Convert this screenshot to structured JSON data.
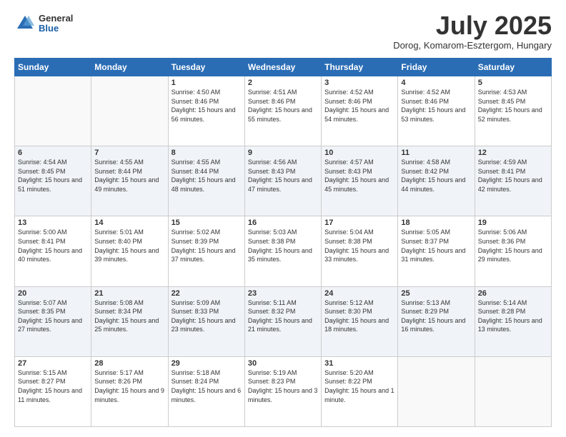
{
  "header": {
    "logo_general": "General",
    "logo_blue": "Blue",
    "title": "July 2025",
    "location": "Dorog, Komarom-Esztergom, Hungary"
  },
  "days_of_week": [
    "Sunday",
    "Monday",
    "Tuesday",
    "Wednesday",
    "Thursday",
    "Friday",
    "Saturday"
  ],
  "weeks": [
    [
      {
        "day": "",
        "sunrise": "",
        "sunset": "",
        "daylight": ""
      },
      {
        "day": "",
        "sunrise": "",
        "sunset": "",
        "daylight": ""
      },
      {
        "day": "1",
        "sunrise": "Sunrise: 4:50 AM",
        "sunset": "Sunset: 8:46 PM",
        "daylight": "Daylight: 15 hours and 56 minutes."
      },
      {
        "day": "2",
        "sunrise": "Sunrise: 4:51 AM",
        "sunset": "Sunset: 8:46 PM",
        "daylight": "Daylight: 15 hours and 55 minutes."
      },
      {
        "day": "3",
        "sunrise": "Sunrise: 4:52 AM",
        "sunset": "Sunset: 8:46 PM",
        "daylight": "Daylight: 15 hours and 54 minutes."
      },
      {
        "day": "4",
        "sunrise": "Sunrise: 4:52 AM",
        "sunset": "Sunset: 8:46 PM",
        "daylight": "Daylight: 15 hours and 53 minutes."
      },
      {
        "day": "5",
        "sunrise": "Sunrise: 4:53 AM",
        "sunset": "Sunset: 8:45 PM",
        "daylight": "Daylight: 15 hours and 52 minutes."
      }
    ],
    [
      {
        "day": "6",
        "sunrise": "Sunrise: 4:54 AM",
        "sunset": "Sunset: 8:45 PM",
        "daylight": "Daylight: 15 hours and 51 minutes."
      },
      {
        "day": "7",
        "sunrise": "Sunrise: 4:55 AM",
        "sunset": "Sunset: 8:44 PM",
        "daylight": "Daylight: 15 hours and 49 minutes."
      },
      {
        "day": "8",
        "sunrise": "Sunrise: 4:55 AM",
        "sunset": "Sunset: 8:44 PM",
        "daylight": "Daylight: 15 hours and 48 minutes."
      },
      {
        "day": "9",
        "sunrise": "Sunrise: 4:56 AM",
        "sunset": "Sunset: 8:43 PM",
        "daylight": "Daylight: 15 hours and 47 minutes."
      },
      {
        "day": "10",
        "sunrise": "Sunrise: 4:57 AM",
        "sunset": "Sunset: 8:43 PM",
        "daylight": "Daylight: 15 hours and 45 minutes."
      },
      {
        "day": "11",
        "sunrise": "Sunrise: 4:58 AM",
        "sunset": "Sunset: 8:42 PM",
        "daylight": "Daylight: 15 hours and 44 minutes."
      },
      {
        "day": "12",
        "sunrise": "Sunrise: 4:59 AM",
        "sunset": "Sunset: 8:41 PM",
        "daylight": "Daylight: 15 hours and 42 minutes."
      }
    ],
    [
      {
        "day": "13",
        "sunrise": "Sunrise: 5:00 AM",
        "sunset": "Sunset: 8:41 PM",
        "daylight": "Daylight: 15 hours and 40 minutes."
      },
      {
        "day": "14",
        "sunrise": "Sunrise: 5:01 AM",
        "sunset": "Sunset: 8:40 PM",
        "daylight": "Daylight: 15 hours and 39 minutes."
      },
      {
        "day": "15",
        "sunrise": "Sunrise: 5:02 AM",
        "sunset": "Sunset: 8:39 PM",
        "daylight": "Daylight: 15 hours and 37 minutes."
      },
      {
        "day": "16",
        "sunrise": "Sunrise: 5:03 AM",
        "sunset": "Sunset: 8:38 PM",
        "daylight": "Daylight: 15 hours and 35 minutes."
      },
      {
        "day": "17",
        "sunrise": "Sunrise: 5:04 AM",
        "sunset": "Sunset: 8:38 PM",
        "daylight": "Daylight: 15 hours and 33 minutes."
      },
      {
        "day": "18",
        "sunrise": "Sunrise: 5:05 AM",
        "sunset": "Sunset: 8:37 PM",
        "daylight": "Daylight: 15 hours and 31 minutes."
      },
      {
        "day": "19",
        "sunrise": "Sunrise: 5:06 AM",
        "sunset": "Sunset: 8:36 PM",
        "daylight": "Daylight: 15 hours and 29 minutes."
      }
    ],
    [
      {
        "day": "20",
        "sunrise": "Sunrise: 5:07 AM",
        "sunset": "Sunset: 8:35 PM",
        "daylight": "Daylight: 15 hours and 27 minutes."
      },
      {
        "day": "21",
        "sunrise": "Sunrise: 5:08 AM",
        "sunset": "Sunset: 8:34 PM",
        "daylight": "Daylight: 15 hours and 25 minutes."
      },
      {
        "day": "22",
        "sunrise": "Sunrise: 5:09 AM",
        "sunset": "Sunset: 8:33 PM",
        "daylight": "Daylight: 15 hours and 23 minutes."
      },
      {
        "day": "23",
        "sunrise": "Sunrise: 5:11 AM",
        "sunset": "Sunset: 8:32 PM",
        "daylight": "Daylight: 15 hours and 21 minutes."
      },
      {
        "day": "24",
        "sunrise": "Sunrise: 5:12 AM",
        "sunset": "Sunset: 8:30 PM",
        "daylight": "Daylight: 15 hours and 18 minutes."
      },
      {
        "day": "25",
        "sunrise": "Sunrise: 5:13 AM",
        "sunset": "Sunset: 8:29 PM",
        "daylight": "Daylight: 15 hours and 16 minutes."
      },
      {
        "day": "26",
        "sunrise": "Sunrise: 5:14 AM",
        "sunset": "Sunset: 8:28 PM",
        "daylight": "Daylight: 15 hours and 13 minutes."
      }
    ],
    [
      {
        "day": "27",
        "sunrise": "Sunrise: 5:15 AM",
        "sunset": "Sunset: 8:27 PM",
        "daylight": "Daylight: 15 hours and 11 minutes."
      },
      {
        "day": "28",
        "sunrise": "Sunrise: 5:17 AM",
        "sunset": "Sunset: 8:26 PM",
        "daylight": "Daylight: 15 hours and 9 minutes."
      },
      {
        "day": "29",
        "sunrise": "Sunrise: 5:18 AM",
        "sunset": "Sunset: 8:24 PM",
        "daylight": "Daylight: 15 hours and 6 minutes."
      },
      {
        "day": "30",
        "sunrise": "Sunrise: 5:19 AM",
        "sunset": "Sunset: 8:23 PM",
        "daylight": "Daylight: 15 hours and 3 minutes."
      },
      {
        "day": "31",
        "sunrise": "Sunrise: 5:20 AM",
        "sunset": "Sunset: 8:22 PM",
        "daylight": "Daylight: 15 hours and 1 minute."
      },
      {
        "day": "",
        "sunrise": "",
        "sunset": "",
        "daylight": ""
      },
      {
        "day": "",
        "sunrise": "",
        "sunset": "",
        "daylight": ""
      }
    ]
  ]
}
